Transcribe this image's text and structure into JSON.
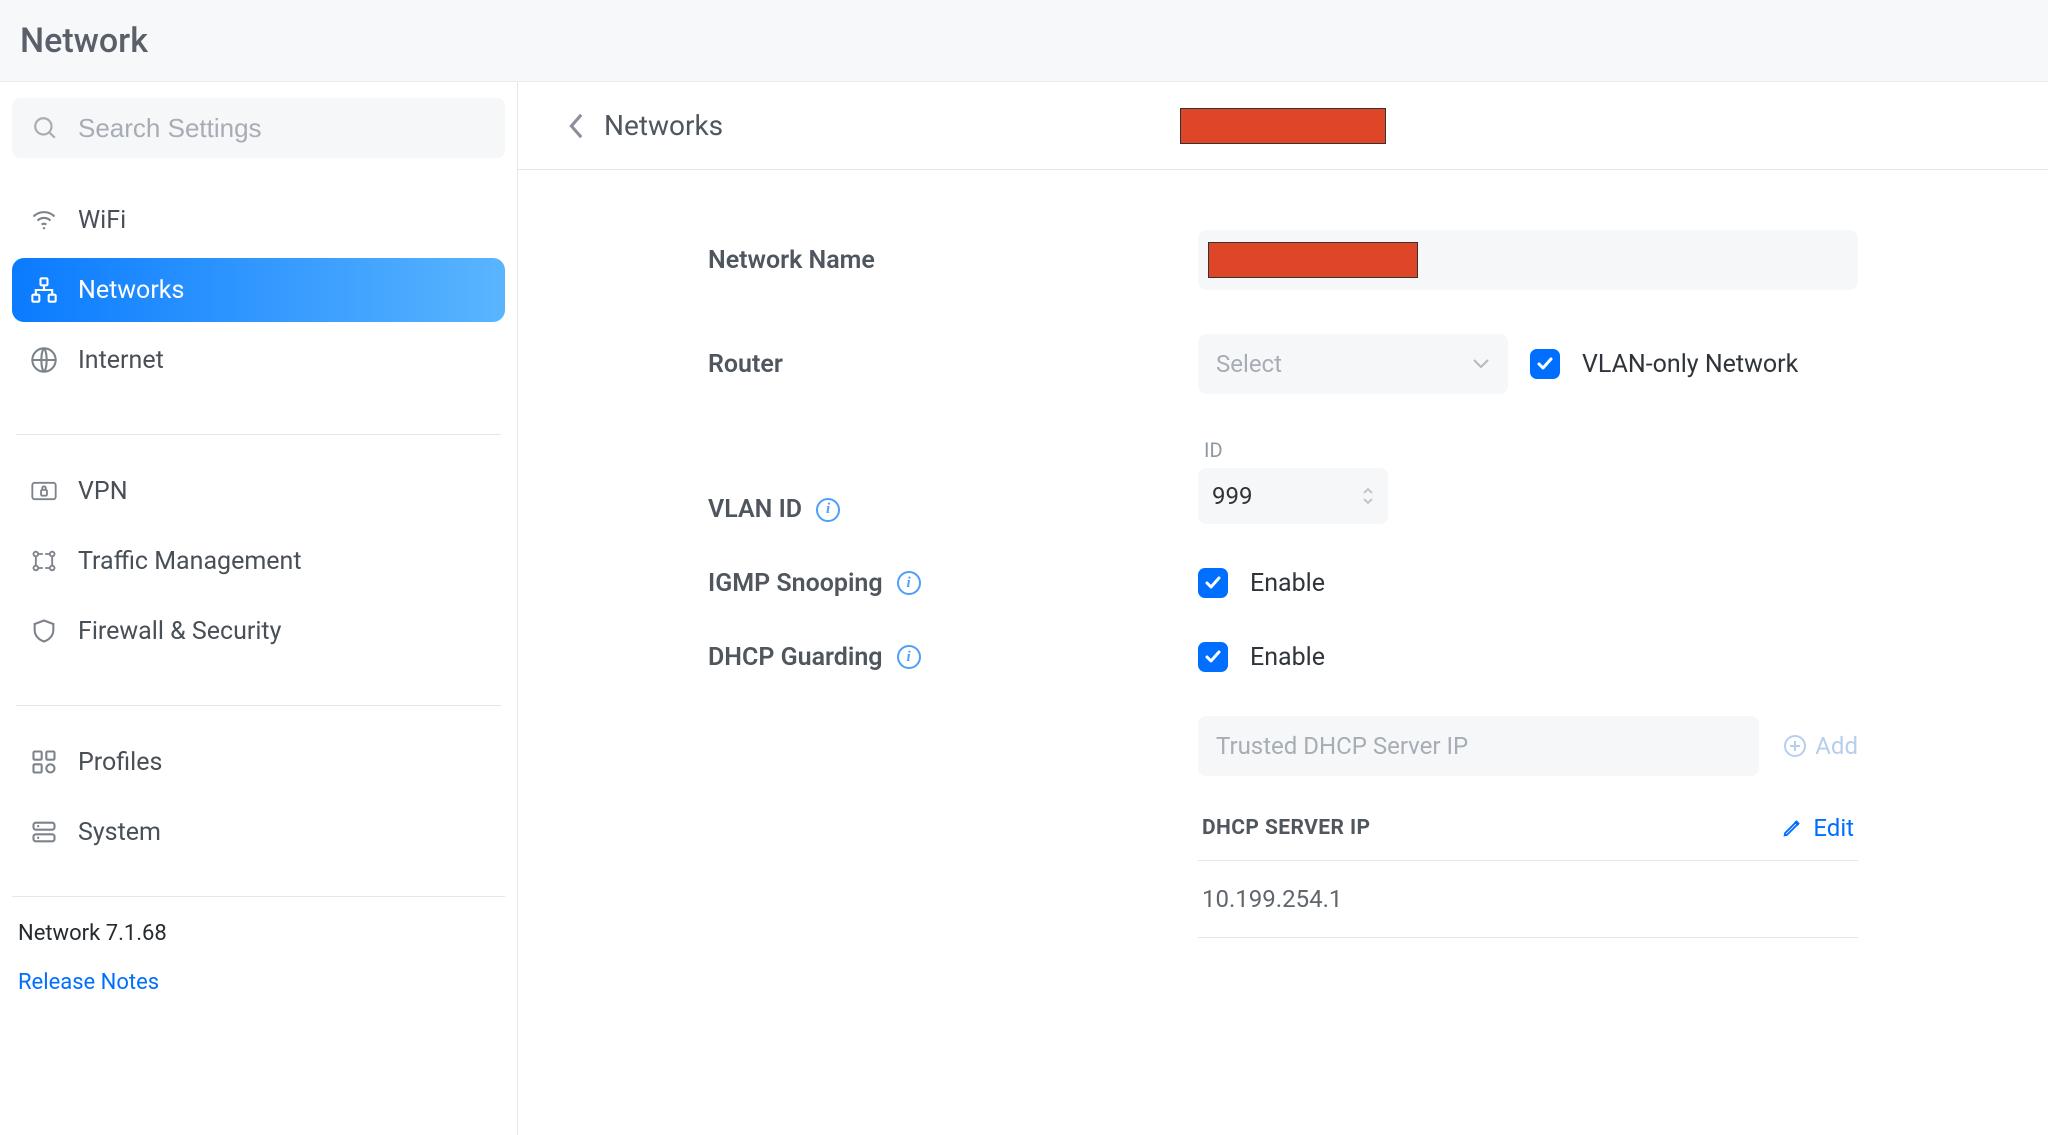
{
  "header": {
    "title": "Network"
  },
  "sidebar": {
    "search_placeholder": "Search Settings",
    "groups": [
      {
        "items": [
          {
            "label": "WiFi"
          },
          {
            "label": "Networks",
            "active": true
          },
          {
            "label": "Internet"
          }
        ]
      },
      {
        "items": [
          {
            "label": "VPN"
          },
          {
            "label": "Traffic Management"
          },
          {
            "label": "Firewall & Security"
          }
        ]
      },
      {
        "items": [
          {
            "label": "Profiles"
          },
          {
            "label": "System"
          }
        ]
      }
    ],
    "footer": {
      "version": "Network 7.1.68",
      "release_notes": "Release Notes"
    }
  },
  "breadcrumb": {
    "back_label": "Networks"
  },
  "form": {
    "network_name": {
      "label": "Network Name"
    },
    "router": {
      "label": "Router",
      "placeholder": "Select",
      "vlan_only_label": "VLAN-only Network",
      "vlan_only_checked": true
    },
    "vlan_id": {
      "label": "VLAN ID",
      "sub_label": "ID",
      "value": "999"
    },
    "igmp": {
      "label": "IGMP Snooping",
      "enable_label": "Enable",
      "checked": true
    },
    "dhcp_guarding": {
      "label": "DHCP Guarding",
      "enable_label": "Enable",
      "checked": true
    },
    "dhcp_servers": {
      "input_placeholder": "Trusted DHCP Server IP",
      "add_label": "Add",
      "column_header": "DHCP SERVER IP",
      "edit_label": "Edit",
      "rows": [
        "10.199.254.1"
      ]
    }
  }
}
